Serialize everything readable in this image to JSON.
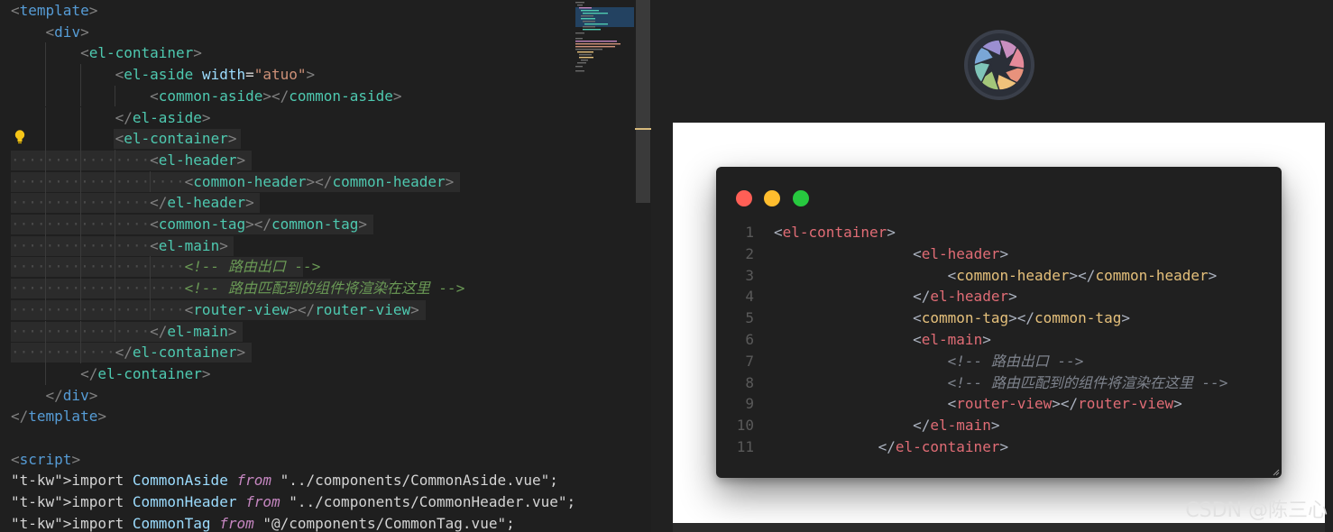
{
  "editor": {
    "lines": [
      "<template>",
      "    <div>",
      "        <el-container>",
      "            <el-aside width=\"atuo\">",
      "                <common-aside></common-aside>",
      "            </el-aside>",
      "            <el-container>",
      "                <el-header>",
      "                    <common-header></common-header>",
      "                </el-header>",
      "                <common-tag></common-tag>",
      "                <el-main>",
      "                    <!-- 路由出口 -->",
      "                    <!-- 路由匹配到的组件将渲染在这里 -->",
      "                    <router-view></router-view>",
      "                </el-main>",
      "            </el-container>",
      "        </el-container>",
      "    </div>",
      "</template>",
      "",
      "<script>",
      "import CommonAside from \"../components/CommonAside.vue\";",
      "import CommonHeader from \"../components/CommonHeader.vue\";",
      "import CommonTag from \"@/components/CommonTag.vue\";"
    ]
  },
  "preview": {
    "line_numbers": [
      "1",
      "2",
      "3",
      "4",
      "5",
      "6",
      "7",
      "8",
      "9",
      "10",
      "11"
    ],
    "code_lines": [
      "<el-container>",
      "                <el-header>",
      "                    <common-header></common-header>",
      "                </el-header>",
      "                <common-tag></common-tag>",
      "                <el-main>",
      "                    <!-- 路由出口 -->",
      "                    <!-- 路由匹配到的组件将渲染在这里 -->",
      "                    <router-view></router-view>",
      "                </el-main>",
      "            </el-container>"
    ],
    "window_dots": [
      "#ff5f56",
      "#ffbd2e",
      "#27c93f"
    ],
    "logo_icon": "camera-aperture-icon"
  },
  "watermark": "CSDN @陈三心",
  "colors": {
    "editor_bg": "#1f1f1f",
    "code_card_bg": "#202020",
    "preview_bg": "#212121"
  }
}
